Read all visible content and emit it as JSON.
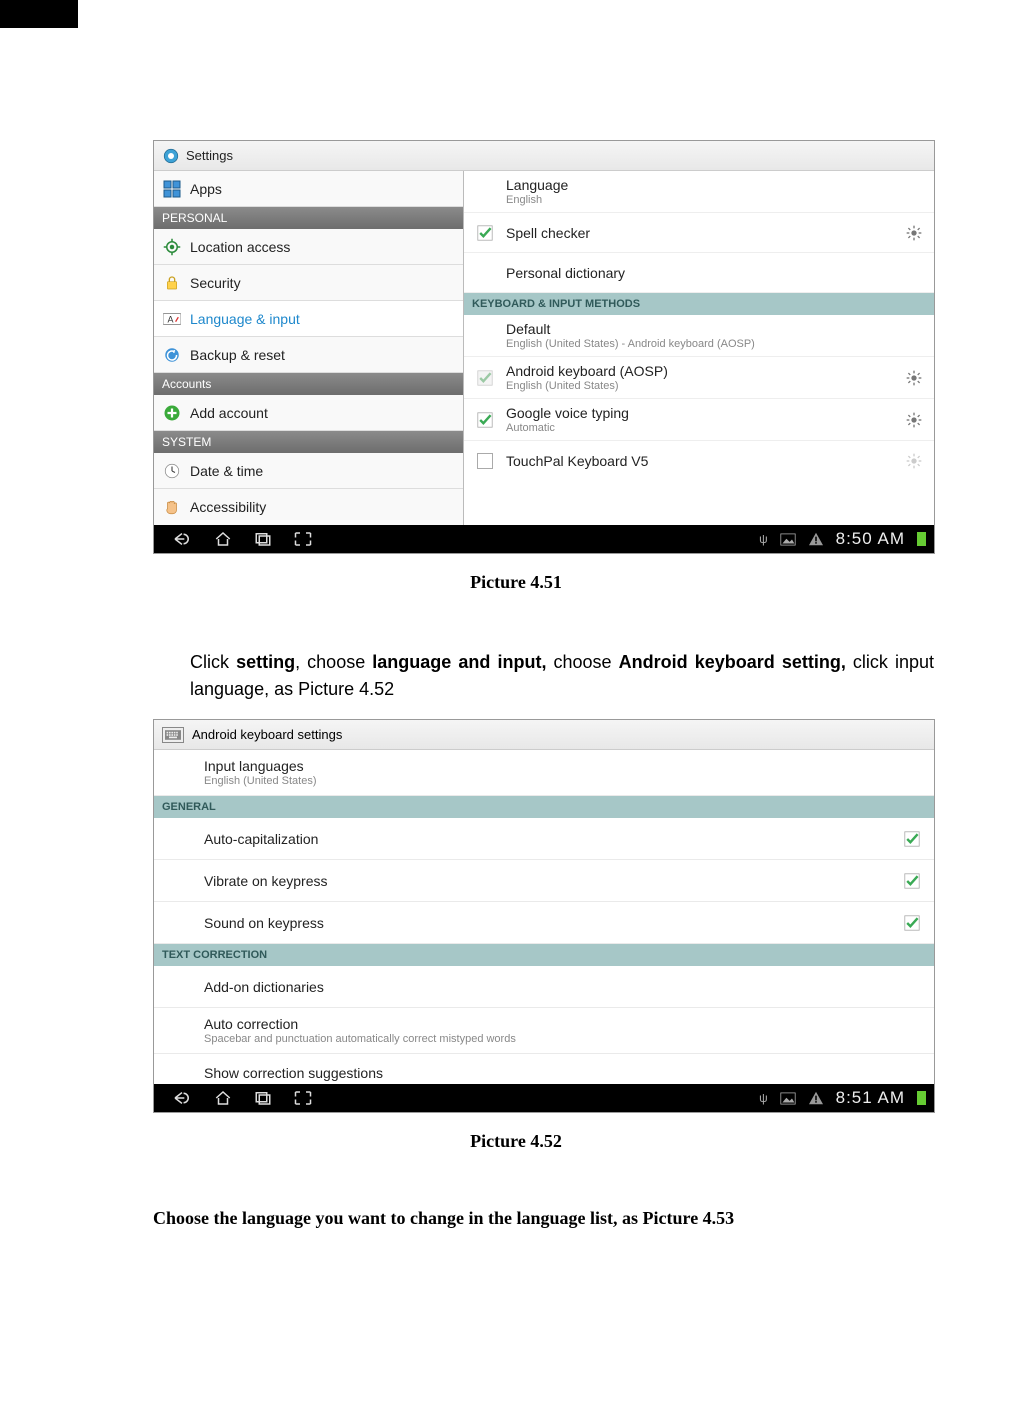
{
  "screenshot1": {
    "header_title": "Settings",
    "nav_apps": "Apps",
    "cat_personal": "PERSONAL",
    "nav_location": "Location access",
    "nav_security": "Security",
    "nav_language": "Language & input",
    "nav_backup": "Backup & reset",
    "cat_accounts": "Accounts",
    "nav_add_account": "Add account",
    "cat_system": "SYSTEM",
    "nav_datetime": "Date & time",
    "nav_accessibility": "Accessibility",
    "r_language_title": "Language",
    "r_language_sub": "English",
    "r_spell": "Spell checker",
    "r_personal_dict": "Personal dictionary",
    "cat_keyboard": "KEYBOARD & INPUT METHODS",
    "r_default_title": "Default",
    "r_default_sub": "English (United States) - Android keyboard (AOSP)",
    "r_android_kb_title": "Android keyboard (AOSP)",
    "r_android_kb_sub": "English (United States)",
    "r_google_voice_title": "Google voice typing",
    "r_google_voice_sub": "Automatic",
    "r_touchpal_title": "TouchPal Keyboard V5",
    "status_time": "8:50 AM"
  },
  "caption1": "Picture 4.51",
  "paragraph": {
    "p1a": "Click ",
    "p1b": "setting",
    "p1c": ", choose ",
    "p1d": "language and input,",
    "p1e": "  choose ",
    "p1f": "Android keyboard setting,",
    "p1g": "  click input language, as Picture 4.52"
  },
  "screenshot2": {
    "header_title": "Android keyboard settings",
    "input_lang_title": "Input languages",
    "input_lang_sub": "English (United States)",
    "cat_general": "GENERAL",
    "auto_cap": "Auto-capitalization",
    "vibrate": "Vibrate on keypress",
    "sound": "Sound on keypress",
    "cat_text_corr": "TEXT CORRECTION",
    "addon_dict": "Add-on dictionaries",
    "auto_corr_title": "Auto correction",
    "auto_corr_sub": "Spacebar and punctuation automatically correct mistyped words",
    "show_sugg": "Show correction suggestions",
    "status_time": "8:51 AM"
  },
  "caption2": "Picture 4.52",
  "choose_text": "Choose the language you want to change in the language list, as Picture 4.53"
}
